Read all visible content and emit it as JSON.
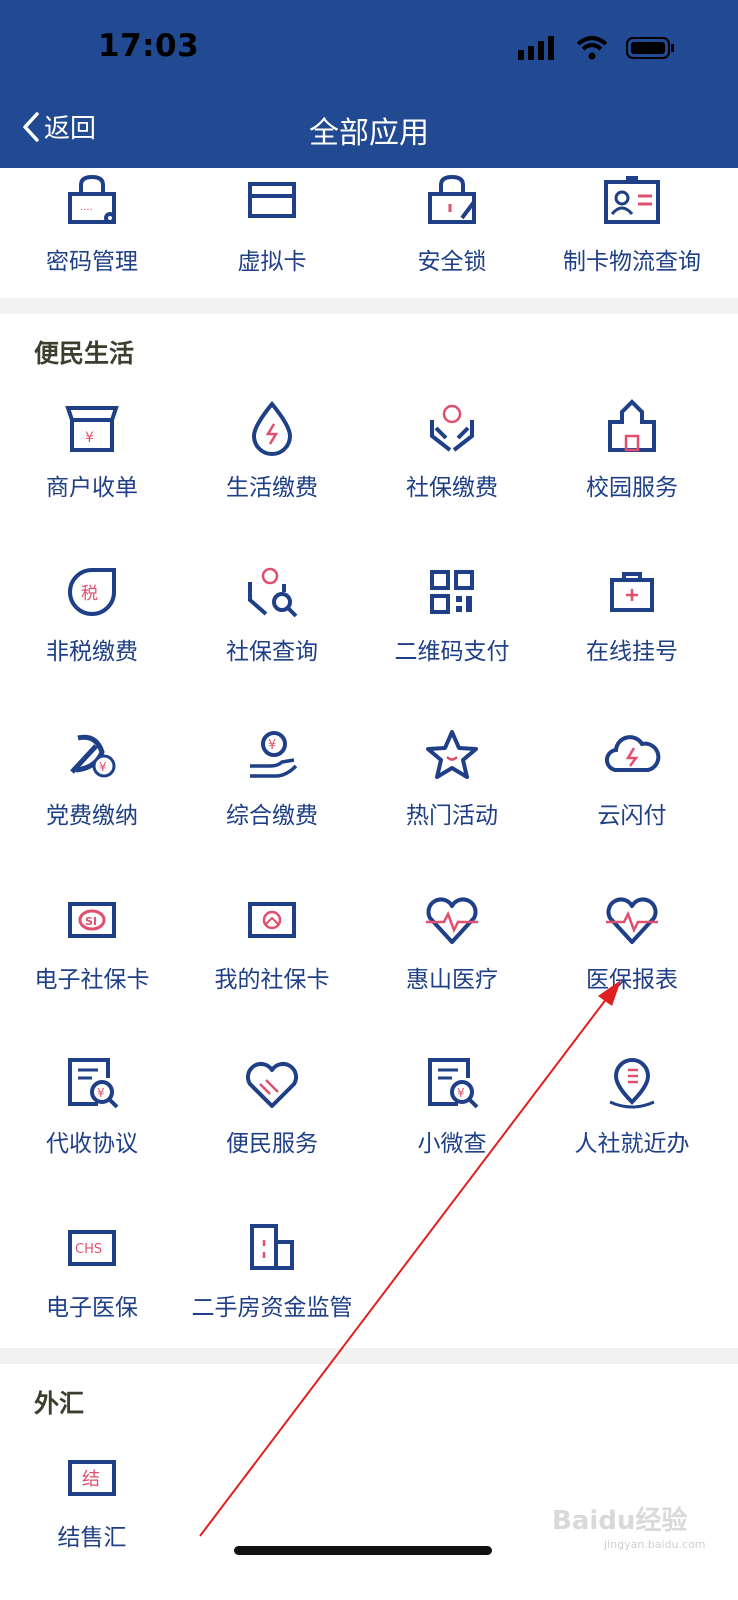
{
  "status": {
    "time": "17:03"
  },
  "nav": {
    "back": "返回",
    "title": "全部应用"
  },
  "top_row": [
    {
      "label": "密码管理",
      "icon": "password-lock-icon"
    },
    {
      "label": "虚拟卡",
      "icon": "card-icon"
    },
    {
      "label": "安全锁",
      "icon": "safety-lock-icon"
    },
    {
      "label": "制卡物流查询",
      "icon": "id-card-icon"
    }
  ],
  "life": {
    "title": "便民生活",
    "items": [
      {
        "label": "商户收单",
        "icon": "shop-icon"
      },
      {
        "label": "生活缴费",
        "icon": "water-drop-icon"
      },
      {
        "label": "社保缴费",
        "icon": "hands-globe-icon"
      },
      {
        "label": "校园服务",
        "icon": "school-icon"
      },
      {
        "label": "非税缴费",
        "icon": "tax-icon"
      },
      {
        "label": "社保查询",
        "icon": "hands-search-icon"
      },
      {
        "label": "二维码支付",
        "icon": "qr-code-icon"
      },
      {
        "label": "在线挂号",
        "icon": "medical-kit-icon"
      },
      {
        "label": "党费缴纳",
        "icon": "party-emblem-icon"
      },
      {
        "label": "综合缴费",
        "icon": "hand-coin-icon"
      },
      {
        "label": "热门活动",
        "icon": "star-icon"
      },
      {
        "label": "云闪付",
        "icon": "cloud-flash-icon"
      },
      {
        "label": "电子社保卡",
        "icon": "si-card-icon"
      },
      {
        "label": "我的社保卡",
        "icon": "social-card-icon"
      },
      {
        "label": "惠山医疗",
        "icon": "heart-pulse-icon"
      },
      {
        "label": "医保报表",
        "icon": "heart-pulse-icon"
      },
      {
        "label": "代收协议",
        "icon": "doc-yen-search-icon"
      },
      {
        "label": "便民服务",
        "icon": "heart-handshake-icon"
      },
      {
        "label": "小微查",
        "icon": "doc-yen-search-icon"
      },
      {
        "label": "人社就近办",
        "icon": "location-pin-icon"
      },
      {
        "label": "电子医保",
        "icon": "chs-card-icon"
      },
      {
        "label": "二手房资金监管",
        "icon": "building-icon"
      }
    ]
  },
  "forex": {
    "title": "外汇",
    "items": [
      {
        "label": "结售汇",
        "icon": "settlement-icon"
      }
    ]
  },
  "icon_text": {
    "yen": "¥",
    "tax": "税",
    "si": "SI",
    "chs": "CHS",
    "jie": "结"
  },
  "watermark": {
    "main": "Baidu经验",
    "sub": "jingyan.baidu.com"
  },
  "colors": {
    "header": "#214a93",
    "icon_blue": "#1f3f87",
    "accent_pink": "#e0506e",
    "label": "#1f3f87",
    "annotation": "#e02020"
  }
}
